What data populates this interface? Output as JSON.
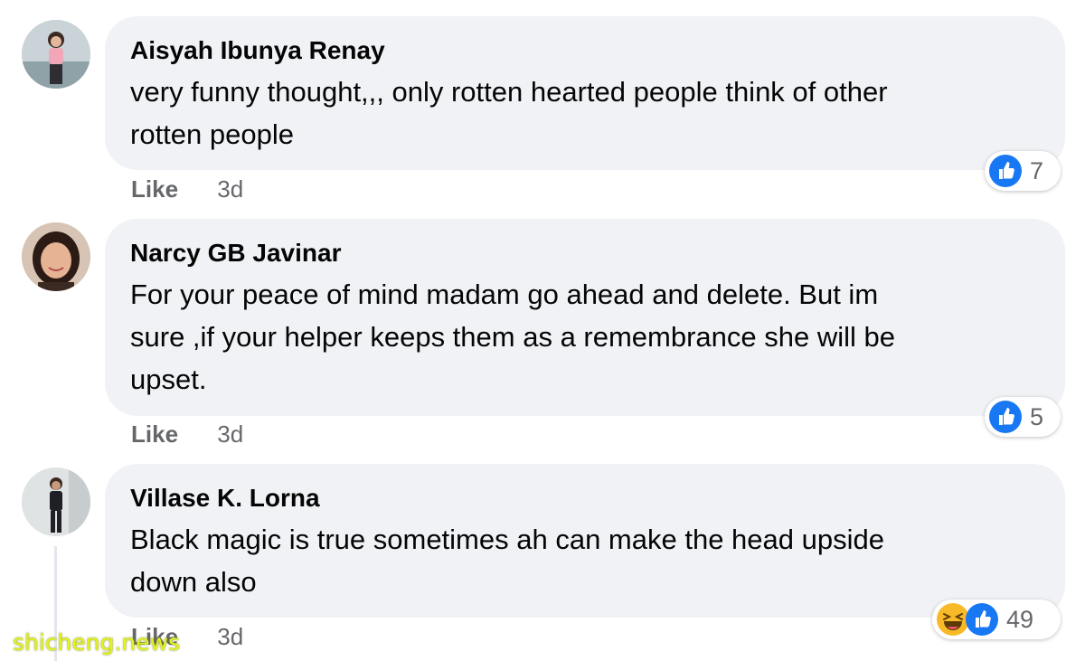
{
  "comments": [
    {
      "author": "Aisyah Ibunya Renay",
      "text_lines": [
        "very funny thought,,, only rotten hearted people think of other",
        "rotten people"
      ],
      "like_label": "Like",
      "time": "3d",
      "reaction_count": "7",
      "reaction_icons": [
        "like-icon"
      ]
    },
    {
      "author": "Narcy GB Javinar",
      "text_lines": [
        "For your peace of mind madam go ahead and delete. But im",
        "sure ,if your helper keeps them as a remembrance she will be",
        "upset."
      ],
      "like_label": "Like",
      "time": "3d",
      "reaction_count": "5",
      "reaction_icons": [
        "like-icon"
      ]
    },
    {
      "author": "Villase K. Lorna",
      "text_lines": [
        "Black magic is true sometimes ah can make the head upside",
        "down also"
      ],
      "like_label": "Like",
      "time": "3d",
      "reaction_count": "49",
      "reaction_icons": [
        "haha-icon",
        "like-icon"
      ]
    }
  ],
  "watermark": "shicheng.news",
  "colors": {
    "bubble": "#f0f2f5",
    "like_blue": "#1877f2",
    "haha_yellow": "#f7b928",
    "meta_gray": "#65676b"
  }
}
